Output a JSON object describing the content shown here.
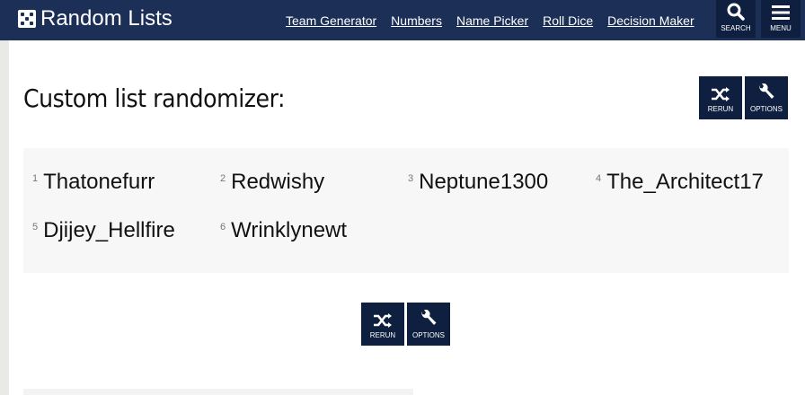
{
  "header": {
    "logo_text": "Random Lists",
    "nav": [
      "Team Generator",
      "Numbers",
      "Name Picker",
      "Roll Dice",
      "Decision Maker"
    ],
    "search_label": "SEARCH",
    "menu_label": "MENU"
  },
  "main": {
    "title": "Custom list randomizer:",
    "rerun_label": "RERUN",
    "options_label": "OPTIONS",
    "items": [
      {
        "num": "1",
        "name": "Thatonefurr"
      },
      {
        "num": "2",
        "name": "Redwishy"
      },
      {
        "num": "3",
        "name": "Neptune1300"
      },
      {
        "num": "4",
        "name": "The_Architect17"
      },
      {
        "num": "5",
        "name": "Djijey_Hellfire"
      },
      {
        "num": "6",
        "name": "Wrinklynewt"
      }
    ]
  },
  "colors": {
    "header_bg": "#1b2f57",
    "button_bg": "#0f1f3f",
    "list_bg": "#f7f7f7"
  }
}
